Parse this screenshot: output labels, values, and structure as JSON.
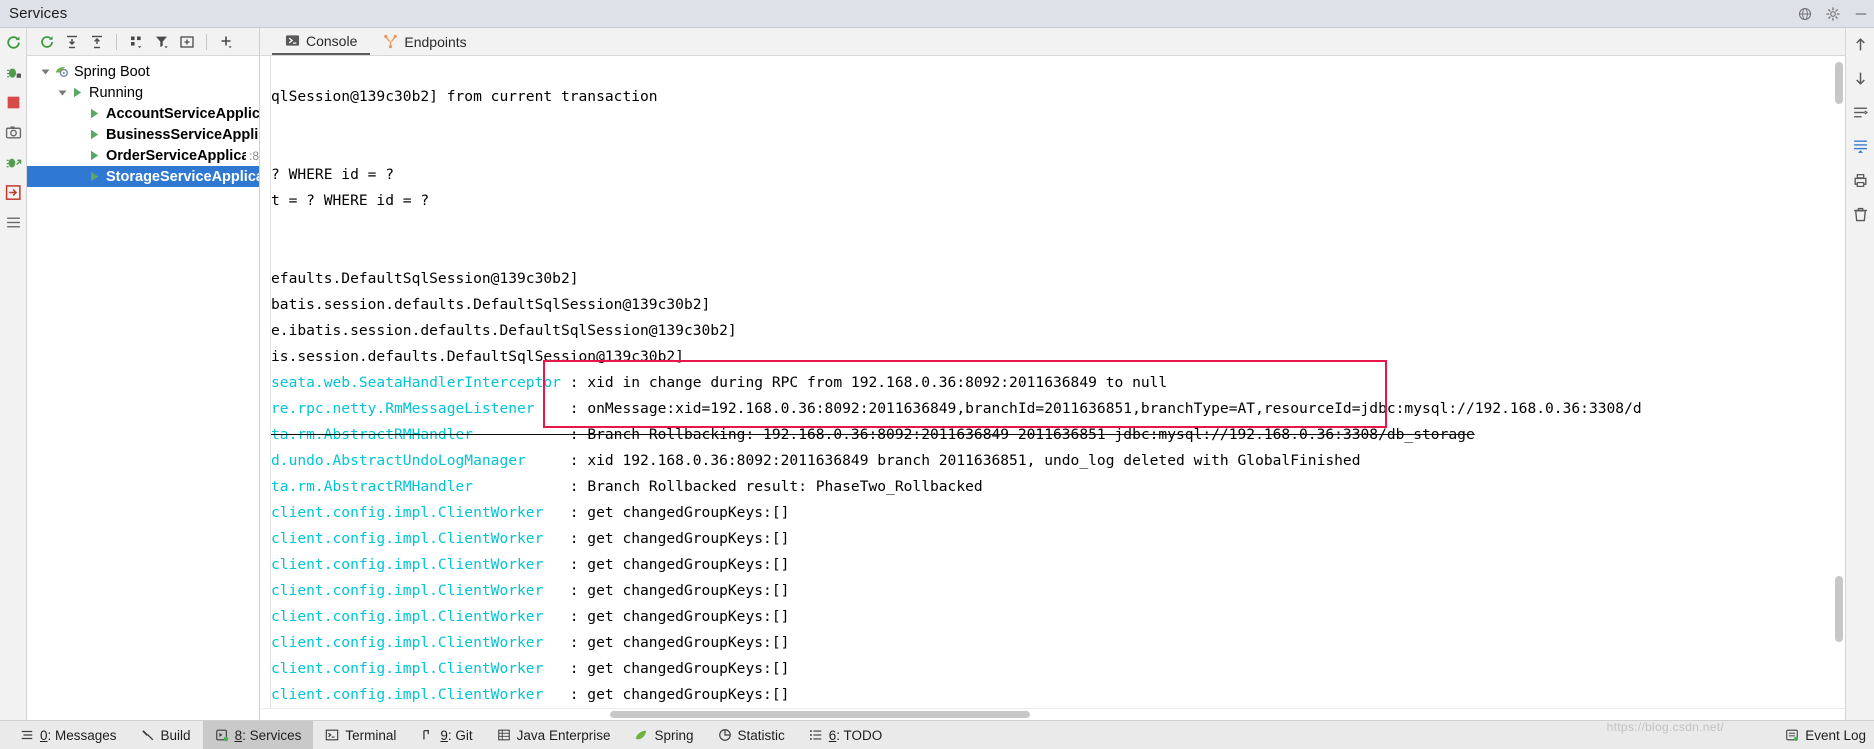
{
  "window": {
    "title": "Services",
    "buttons": [
      "globe-icon",
      "settings-gear-icon",
      "minimize-icon"
    ]
  },
  "left_rail": {
    "icons": [
      "rerun-icon",
      "debug-rerun-icon",
      "stop-icon",
      "camera-icon",
      "debug-attach-icon",
      "exit-icon",
      "layout-icon"
    ]
  },
  "services_toolbar": {
    "buttons": [
      "rerun-icon",
      "expand-all-icon",
      "collapse-all-icon",
      "group-by-icon",
      "filter-icon",
      "add-tab-icon",
      "add-icon"
    ]
  },
  "tree": {
    "items": [
      {
        "label": "Spring Boot",
        "indent": 0,
        "icon": "spring-boot-icon",
        "arrow": "down",
        "bold": false,
        "selected": false,
        "port": ""
      },
      {
        "label": "Running",
        "indent": 1,
        "icon": "run-green-icon",
        "arrow": "down",
        "bold": false,
        "selected": false,
        "port": ""
      },
      {
        "label": "AccountServiceApplication",
        "indent": 2,
        "icon": "run-green-icon",
        "arrow": "none",
        "bold": true,
        "selected": false,
        "port": ""
      },
      {
        "label": "BusinessServiceApplication",
        "indent": 2,
        "icon": "run-green-icon",
        "arrow": "none",
        "bold": true,
        "selected": false,
        "port": ""
      },
      {
        "label": "OrderServiceApplication",
        "indent": 2,
        "icon": "run-green-icon",
        "arrow": "none",
        "bold": true,
        "selected": false,
        "port": ":8"
      },
      {
        "label": "StorageServiceApplication",
        "indent": 2,
        "icon": "run-green-icon",
        "arrow": "none",
        "bold": true,
        "selected": true,
        "port": ""
      }
    ],
    "selection_color": "#2f79d2"
  },
  "tabs": [
    {
      "label": "Console",
      "icon": "console-icon",
      "active": true
    },
    {
      "label": "Endpoints",
      "icon": "endpoints-icon",
      "active": false
    }
  ],
  "console": {
    "logger_color": "#00c4d6",
    "lines": [
      {
        "logger": "",
        "message": "",
        "strike": false
      },
      {
        "logger": "",
        "message": "qlSession@139c30b2] from current transaction",
        "strike": false
      },
      {
        "logger": "",
        "message": "",
        "strike": false
      },
      {
        "logger": "",
        "message": "",
        "strike": false
      },
      {
        "logger": "",
        "message": "? WHERE id = ?",
        "strike": false
      },
      {
        "logger": "",
        "message": "t = ? WHERE id = ?",
        "strike": false
      },
      {
        "logger": "",
        "message": "",
        "strike": false
      },
      {
        "logger": "",
        "message": "",
        "strike": false
      },
      {
        "logger": "",
        "message": "efaults.DefaultSqlSession@139c30b2]",
        "strike": false
      },
      {
        "logger": "",
        "message": "batis.session.defaults.DefaultSqlSession@139c30b2]",
        "strike": false
      },
      {
        "logger": "",
        "message": "e.ibatis.session.defaults.DefaultSqlSession@139c30b2]",
        "strike": false
      },
      {
        "logger": "",
        "message": "is.session.defaults.DefaultSqlSession@139c30b2]",
        "strike": false
      },
      {
        "logger": "seata.web.SeataHandlerInterceptor",
        "message": ": xid in change during RPC from 192.168.0.36:8092:2011636849 to null",
        "strike": false
      },
      {
        "logger": "re.rpc.netty.RmMessageListener",
        "message": ": onMessage:xid=192.168.0.36:8092:2011636849,branchId=2011636851,branchType=AT,resourceId=jdbc:mysql://192.168.0.36:3308/d",
        "strike": false
      },
      {
        "logger": "ta.rm.AbstractRMHandler",
        "message": ": Branch Rollbacking: 192.168.0.36:8092:2011636849 2011636851 jdbc:mysql://192.168.0.36:3308/db_storage",
        "strike": true
      },
      {
        "logger": "d.undo.AbstractUndoLogManager",
        "message": ": xid 192.168.0.36:8092:2011636849 branch 2011636851, undo_log deleted with GlobalFinished",
        "strike": false
      },
      {
        "logger": "ta.rm.AbstractRMHandler",
        "message": ": Branch Rollbacked result: PhaseTwo_Rollbacked",
        "strike": false
      },
      {
        "logger": "client.config.impl.ClientWorker",
        "message": ": get changedGroupKeys:[]",
        "strike": false
      },
      {
        "logger": "client.config.impl.ClientWorker",
        "message": ": get changedGroupKeys:[]",
        "strike": false
      },
      {
        "logger": "client.config.impl.ClientWorker",
        "message": ": get changedGroupKeys:[]",
        "strike": false
      },
      {
        "logger": "client.config.impl.ClientWorker",
        "message": ": get changedGroupKeys:[]",
        "strike": false
      },
      {
        "logger": "client.config.impl.ClientWorker",
        "message": ": get changedGroupKeys:[]",
        "strike": false
      },
      {
        "logger": "client.config.impl.ClientWorker",
        "message": ": get changedGroupKeys:[]",
        "strike": false
      },
      {
        "logger": "client.config.impl.ClientWorker",
        "message": ": get changedGroupKeys:[]",
        "strike": false
      },
      {
        "logger": "client.config.impl.ClientWorker",
        "message": ": get changedGroupKeys:[]",
        "strike": false
      }
    ],
    "annotation": {
      "color": "#e8174a",
      "shape": "rectangle"
    }
  },
  "right_rail": {
    "icons": [
      "scroll-up-icon",
      "scroll-down-icon",
      "soft-wrap-icon",
      "scroll-end-icon",
      "print-icon",
      "trash-icon"
    ]
  },
  "statusbar": {
    "items": [
      {
        "num": "0",
        "label": "Messages",
        "icon": "messages-icon",
        "active": false
      },
      {
        "num": "",
        "label": "Build",
        "icon": "build-hammer-icon",
        "active": false
      },
      {
        "num": "8",
        "label": "Services",
        "icon": "services-icon",
        "active": true
      },
      {
        "num": "",
        "label": "Terminal",
        "icon": "terminal-icon",
        "active": false
      },
      {
        "num": "9",
        "label": "Git",
        "icon": "git-branch-icon",
        "active": false
      },
      {
        "num": "",
        "label": "Java Enterprise",
        "icon": "java-enterprise-icon",
        "active": false
      },
      {
        "num": "",
        "label": "Spring",
        "icon": "spring-leaf-icon",
        "active": false
      },
      {
        "num": "",
        "label": "Statistic",
        "icon": "statistic-icon",
        "active": false
      },
      {
        "num": "6",
        "label": "TODO",
        "icon": "todo-icon",
        "active": false
      }
    ],
    "event_log": {
      "label": "Event Log",
      "icon": "event-log-icon"
    }
  },
  "watermark": "https://blog.csdn.net/"
}
